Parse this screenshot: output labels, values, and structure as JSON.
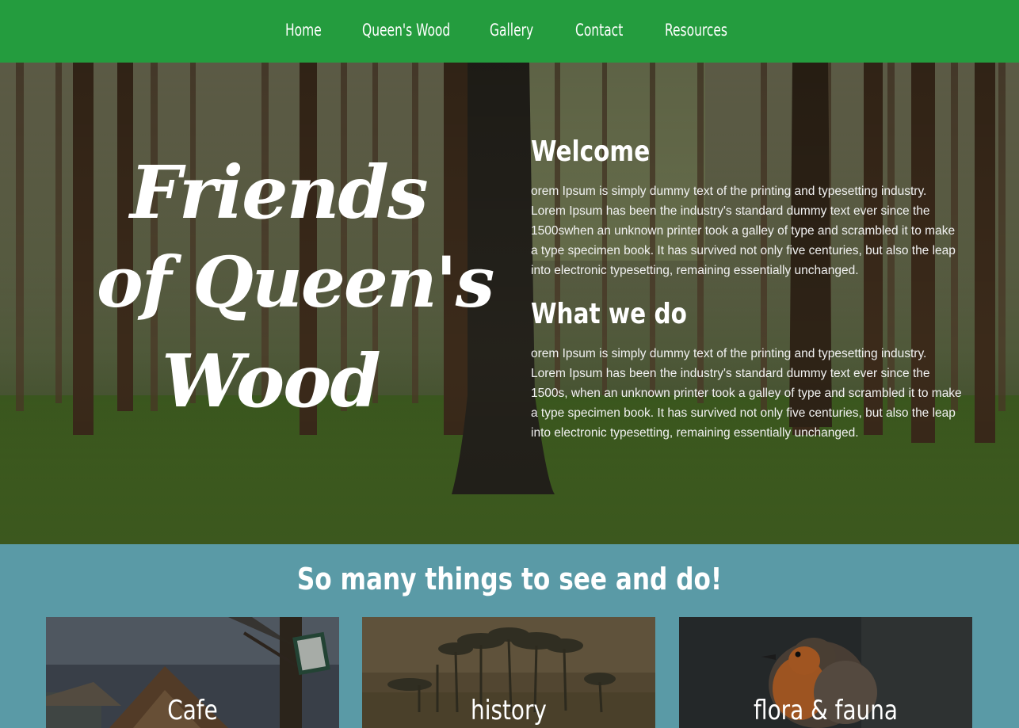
{
  "nav": {
    "items": [
      {
        "label": "Home"
      },
      {
        "label": "Queen's Wood"
      },
      {
        "label": "Gallery"
      },
      {
        "label": "Contact"
      },
      {
        "label": "Resources"
      }
    ]
  },
  "hero": {
    "logo": {
      "line1": "Friends",
      "line2": "of Queen's",
      "line3": "Wood"
    },
    "welcome_heading": "Welcome",
    "welcome_text": "orem Ipsum is simply dummy text of the printing and typesetting industry. Lorem Ipsum has been the industry's standard dummy text ever since the 1500swhen an unknown printer took a galley of type and scrambled it to make a type specimen book. It has survived not only five centuries, but also the leap into electronic typesetting, remaining essentially unchanged.",
    "whatwedo_heading": "What we do",
    "whatwedo_text": "orem Ipsum is simply dummy text of the printing and typesetting industry. Lorem Ipsum has been the industry's standard dummy text ever since the 1500s, when an unknown printer took a galley of type and scrambled it to make a type specimen book. It has survived not only five centuries, but also the leap into electronic typesetting, remaining essentially unchanged."
  },
  "things": {
    "title": "So many things to see and do!",
    "cards": [
      {
        "label": "Cafe"
      },
      {
        "label": "history"
      },
      {
        "label": "flora & fauna"
      }
    ]
  },
  "colors": {
    "nav_bg": "#249c3e",
    "section_bg": "#5a9aa6",
    "text": "#ffffff"
  }
}
